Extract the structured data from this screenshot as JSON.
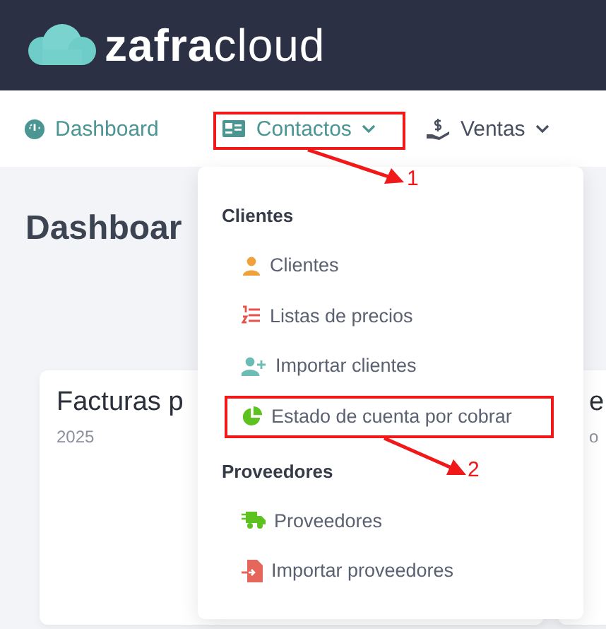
{
  "logo": {
    "bold": "zafra",
    "light": "cloud"
  },
  "nav": [
    {
      "label": "Dashboard",
      "kind": "gauge",
      "accent": true,
      "caret": false
    },
    {
      "label": "Contactos",
      "kind": "card",
      "accent": true,
      "caret": true
    },
    {
      "label": "Ventas",
      "kind": "hand",
      "accent": false,
      "caret": true
    }
  ],
  "page_title": "Dashboar",
  "cards": [
    {
      "title": "Facturas p",
      "subtitle": "2025"
    },
    {
      "title": "e",
      "subtitle": "o"
    }
  ],
  "menu": {
    "sections": [
      {
        "title": "Clientes",
        "items": [
          {
            "label": "Clientes",
            "kind": "person",
            "color": "#f0a23a"
          },
          {
            "label": "Listas de precios",
            "kind": "list",
            "color": "#e5534b"
          },
          {
            "label": "Importar clientes",
            "kind": "adduser",
            "color": "#6cbcb6"
          },
          {
            "label": "Estado de cuenta por cobrar",
            "kind": "pie",
            "color": "#5cc21f"
          }
        ]
      },
      {
        "title": "Proveedores",
        "items": [
          {
            "label": "Proveedores",
            "kind": "truck",
            "color": "#5cc21f"
          },
          {
            "label": "Importar proveedores",
            "kind": "file",
            "color": "#e5665b"
          }
        ]
      }
    ]
  },
  "annotations": [
    {
      "label": "1"
    },
    {
      "label": "2"
    }
  ]
}
